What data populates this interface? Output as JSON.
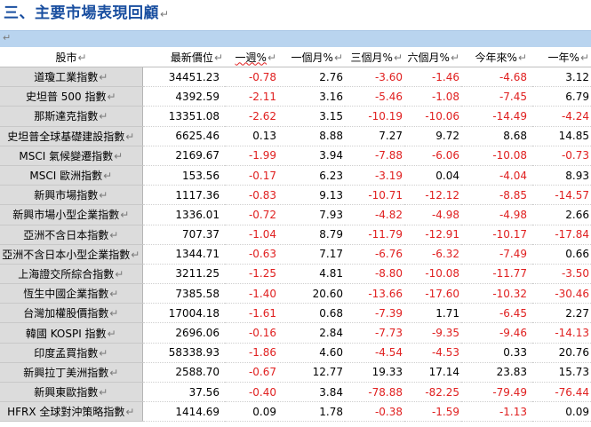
{
  "heading": {
    "title": "三、主要市場表現回顧",
    "para_mark": "↵"
  },
  "bar": {
    "para_mark": "↵"
  },
  "table": {
    "para_mark": "↵",
    "headers": [
      "股市",
      "最新價位",
      "一週%",
      "一個月%",
      "三個月%",
      "六個月%",
      "今年來%",
      "一年%"
    ],
    "rows": [
      [
        "道瓊工業指數",
        "34451.23",
        "-0.78",
        "2.76",
        "-3.60",
        "-1.46",
        "-4.68",
        "3.12"
      ],
      [
        "史坦普 500 指數",
        "4392.59",
        "-2.11",
        "3.16",
        "-5.46",
        "-1.08",
        "-7.45",
        "6.79"
      ],
      [
        "那斯達克指數",
        "13351.08",
        "-2.62",
        "3.15",
        "-10.19",
        "-10.06",
        "-14.49",
        "-4.24"
      ],
      [
        "史坦普全球基礎建設指數",
        "6625.46",
        "0.13",
        "8.88",
        "7.27",
        "9.72",
        "8.68",
        "14.85"
      ],
      [
        "MSCI 氣候變遷指數",
        "2169.67",
        "-1.99",
        "3.94",
        "-7.88",
        "-6.06",
        "-10.08",
        "-0.73"
      ],
      [
        "MSCI 歐洲指數",
        "153.56",
        "-0.17",
        "6.23",
        "-3.19",
        "0.04",
        "-4.04",
        "8.93"
      ],
      [
        "新興市場指數",
        "1117.36",
        "-0.83",
        "9.13",
        "-10.71",
        "-12.12",
        "-8.85",
        "-14.57"
      ],
      [
        "新興市場小型企業指數",
        "1336.01",
        "-0.72",
        "7.93",
        "-4.82",
        "-4.98",
        "-4.98",
        "2.66"
      ],
      [
        "亞洲不含日本指數",
        "707.37",
        "-1.04",
        "8.79",
        "-11.79",
        "-12.91",
        "-10.17",
        "-17.84"
      ],
      [
        "亞洲不含日本小型企業指數",
        "1344.71",
        "-0.63",
        "7.17",
        "-6.76",
        "-6.32",
        "-7.49",
        "0.66"
      ],
      [
        "上海證交所綜合指數",
        "3211.25",
        "-1.25",
        "4.81",
        "-8.80",
        "-10.08",
        "-11.77",
        "-3.50"
      ],
      [
        "恆生中國企業指數",
        "7385.58",
        "-1.40",
        "20.60",
        "-13.66",
        "-17.60",
        "-10.32",
        "-30.46"
      ],
      [
        "台灣加權股價指數",
        "17004.18",
        "-1.61",
        "0.68",
        "-7.39",
        "1.71",
        "-6.45",
        "2.27"
      ],
      [
        "韓國 KOSPI 指數",
        "2696.06",
        "-0.16",
        "2.84",
        "-7.73",
        "-9.35",
        "-9.46",
        "-14.13"
      ],
      [
        "印度孟買指數",
        "58338.93",
        "-1.86",
        "4.60",
        "-4.54",
        "-4.53",
        "0.33",
        "20.76"
      ],
      [
        "新興拉丁美洲指數",
        "2588.70",
        "-0.67",
        "12.77",
        "19.33",
        "17.14",
        "23.83",
        "15.73"
      ],
      [
        "新興東歐指數",
        "37.56",
        "-0.40",
        "3.84",
        "-78.88",
        "-82.25",
        "-79.49",
        "-76.44"
      ],
      [
        "HFRX 全球對沖策略指數",
        "1414.69",
        "0.09",
        "1.78",
        "-0.38",
        "-1.59",
        "-1.13",
        "0.09"
      ]
    ]
  },
  "colors": {
    "negative": "#e02020",
    "positive": "#000000",
    "heading": "#1a4fa0",
    "bar": "#b9d4ef",
    "name_cell": "#dcdcdc"
  }
}
